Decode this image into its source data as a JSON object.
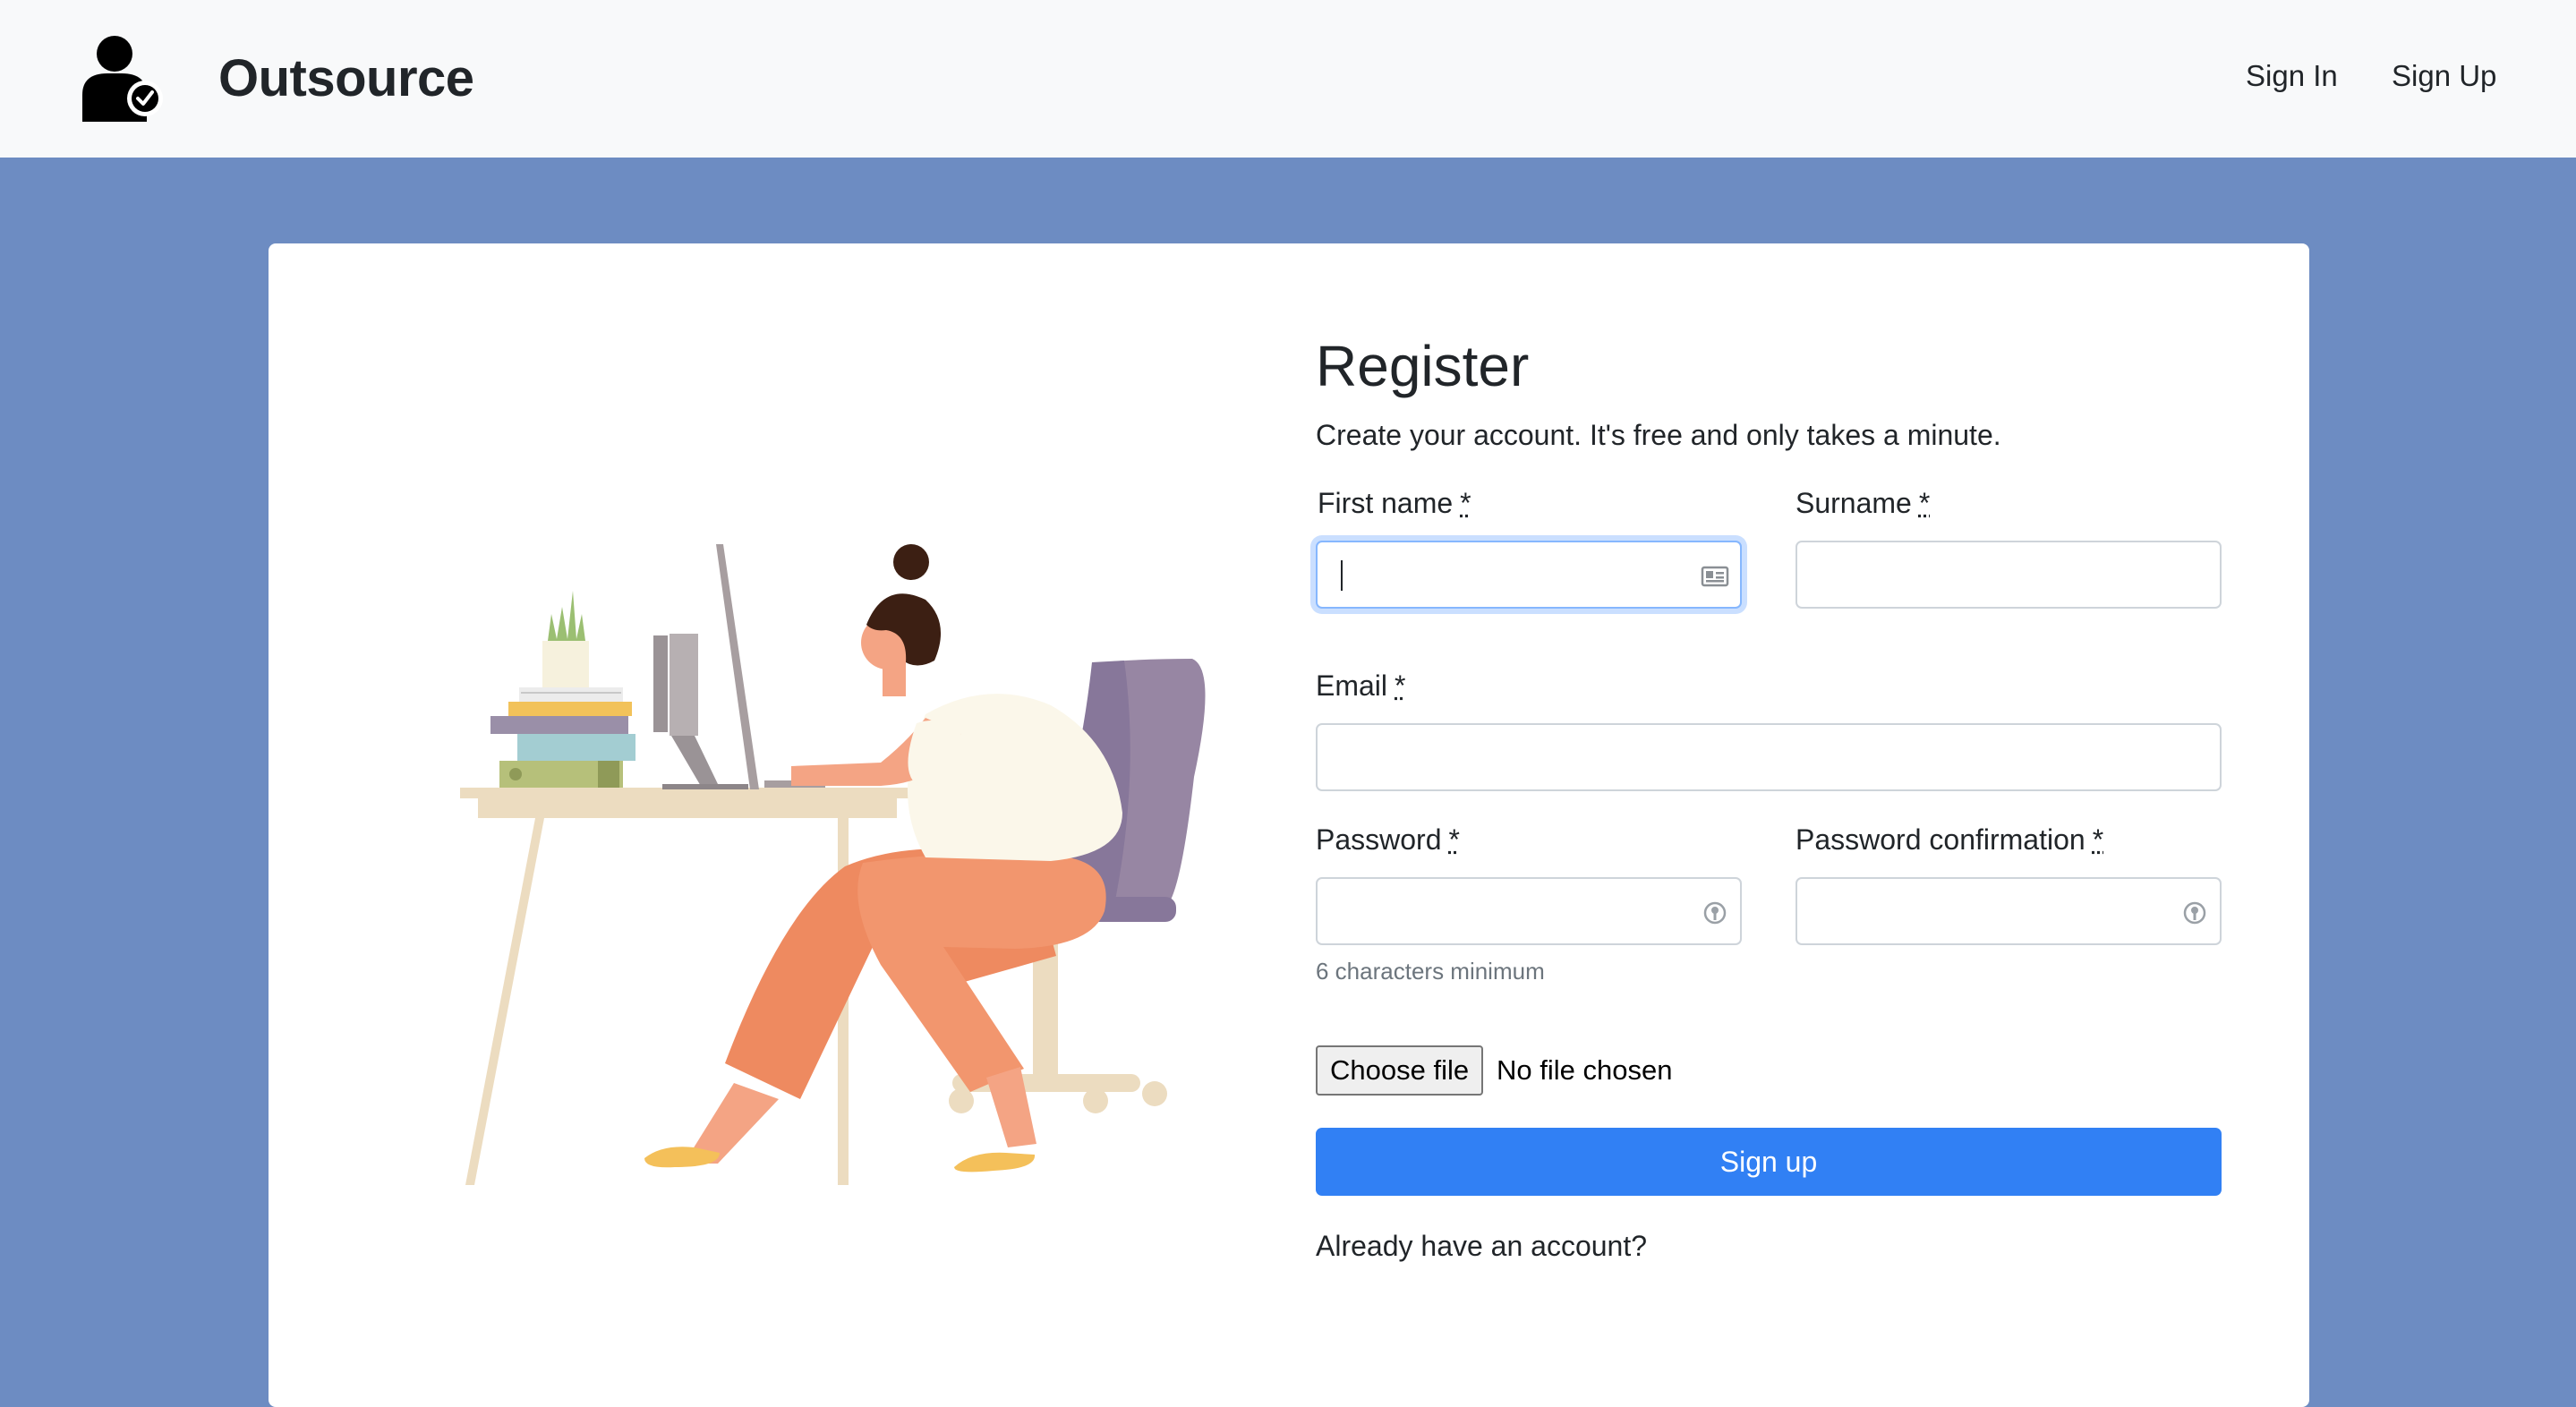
{
  "nav": {
    "brand": "Outsource",
    "sign_in": "Sign In",
    "sign_up": "Sign Up",
    "logo_icon": "user-check-icon"
  },
  "form": {
    "title": "Register",
    "subtitle": "Create your account. It's free and only takes a minute.",
    "required_marker": "*",
    "first_name": {
      "label": "First name",
      "value": "",
      "icon": "contact-card-icon"
    },
    "surname": {
      "label": "Surname",
      "value": ""
    },
    "email": {
      "label": "Email",
      "value": ""
    },
    "password": {
      "label": "Password",
      "value": "",
      "help": "6 characters minimum",
      "icon": "key-icon"
    },
    "password_confirmation": {
      "label": "Password confirmation",
      "value": "",
      "icon": "key-icon"
    },
    "file": {
      "button": "Choose file",
      "status": "No file chosen"
    },
    "submit": "Sign up",
    "login_link": "Already have an account?"
  },
  "colors": {
    "background": "#6d8cc2",
    "navbar": "#f8f9fa",
    "primary": "#3180f4",
    "focus": "#86b7fe"
  },
  "illustration": "person-at-computer-desk"
}
